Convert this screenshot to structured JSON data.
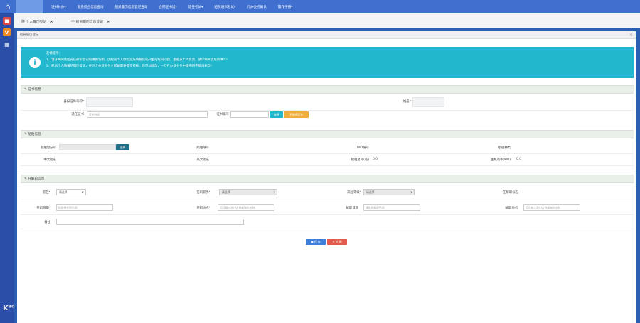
{
  "nav": {
    "items": [
      "证书补办▾",
      "船员综合信息查询",
      "船员履历信息登记查询",
      "合同证书试▾",
      "适任考试▾",
      "船员培训考试▾",
      "代办委托确认",
      "操作手册▾"
    ]
  },
  "tabs": [
    {
      "label": "个人履历登记",
      "icon": "list-icon"
    },
    {
      "label": "船员履历信息登记",
      "icon": "form-icon"
    }
  ],
  "panel": {
    "title": "船员履历登记",
    "close": "×"
  },
  "notice": {
    "title": "友情提示:",
    "line1": "1、请仔细阅读船员任解职登记的填报说明，因船员个人原因造成填报错误产生的任何问题，由船员个人负责，请仔细阅读后再填写!",
    "line2": "2、船员个人填报的履历登记，在同个办证业务之前如需要提交审核，后可以修改，一旦在办证业务中使用则不能再修改!"
  },
  "cert": {
    "section": "证书信息",
    "id_label": "身份证件号码*",
    "name_label": "姓名*",
    "cert_label": "适任证书",
    "cert_type_placeholder": "证书种类",
    "cert_no_label": "证书编号",
    "select_btn": "选择",
    "clear_btn": "不选择证书"
  },
  "ship": {
    "section": "船舶信息",
    "reg_label": "船舶登记号",
    "select_btn": "选择",
    "callsign_label": "船舶呼号",
    "imo_label": "IMO编号",
    "type_label": "船舶种类",
    "cn_name_label": "中文船名",
    "en_name_label": "英文船名",
    "gt_label": "船舶总吨(吨)",
    "gt_value": "0.0",
    "power_label": "主机功率(KW)",
    "power_value": "0.0"
  },
  "duty": {
    "section": "任解职信息",
    "route_label": "航区*",
    "route_value": "请选择",
    "position_label": "任职职务*",
    "position_value": "请选择",
    "dept_label": "岗位等级*",
    "dept_value": "请选择",
    "flag_label": "任解职标志",
    "start_label": "任职日期*",
    "start_placeholder": "请选择任职日期",
    "start_place_label": "任职地点*",
    "start_place_placeholder": "您可输入港口名称或城市名称",
    "end_label": "解职日期",
    "end_placeholder": "请选择解职日期",
    "end_place_label": "解职地点",
    "end_place_placeholder": "您可输入港口名称或城市名称",
    "remark_label": "备注"
  },
  "actions": {
    "save": "保 存",
    "close": "关 闭"
  },
  "watermark": {
    "logo": "K⁹⁰",
    "text": "大数跨境"
  },
  "colors": {
    "topnav": "#3f6fcf",
    "sidebar": "#2b4fa8",
    "notice": "#22b7cc",
    "save_button": "#3d7fd9",
    "close_button": "#e35b4a",
    "select_button": "#22b7cc",
    "clear_button": "#f0ad3e",
    "ship_select_button": "#1f6f87"
  }
}
